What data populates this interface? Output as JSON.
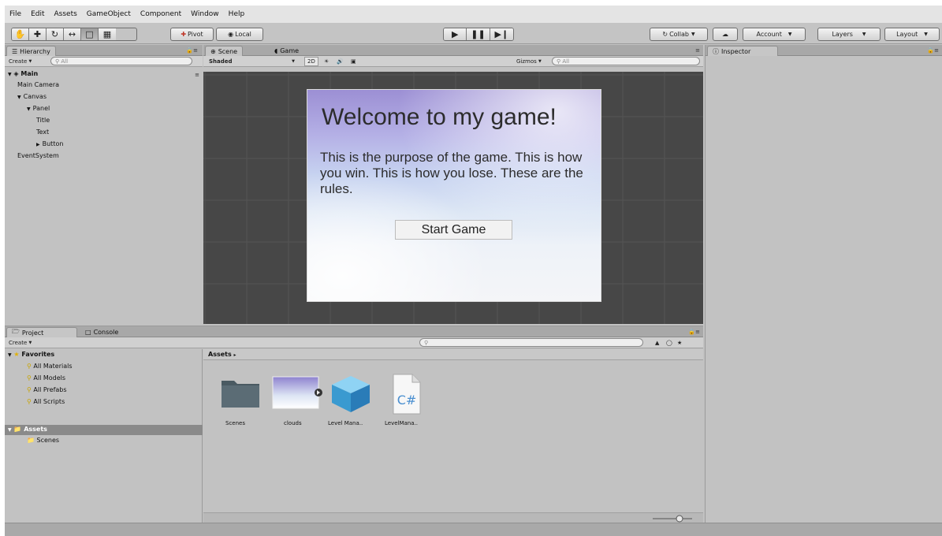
{
  "menu": [
    "File",
    "Edit",
    "Assets",
    "GameObject",
    "Component",
    "Window",
    "Help"
  ],
  "toolbar": {
    "pivot_label": "Pivot",
    "local_label": "Local",
    "collab_label": "Collab",
    "account_label": "Account",
    "layers_label": "Layers",
    "layout_label": "Layout"
  },
  "hierarchy": {
    "tab_label": "Hierarchy",
    "create_label": "Create",
    "search_placeholder": "All",
    "scene_name": "Main",
    "items": [
      {
        "label": "Main Camera",
        "indent": 1
      },
      {
        "label": "Canvas",
        "indent": 1,
        "expanded": true
      },
      {
        "label": "Panel",
        "indent": 2,
        "expanded": true
      },
      {
        "label": "Title",
        "indent": 3
      },
      {
        "label": "Text",
        "indent": 3
      },
      {
        "label": "Button",
        "indent": 3,
        "collapsed": true
      },
      {
        "label": "EventSystem",
        "indent": 1
      }
    ]
  },
  "scene": {
    "tab_scene": "Scene",
    "tab_game": "Game",
    "shading_mode": "Shaded",
    "mode_2d": "2D",
    "gizmos_label": "Gizmos",
    "search_placeholder": "All"
  },
  "game_ui": {
    "title": "Welcome to my game!",
    "body": "This is the purpose of the game. This is how you win. This is how you lose. These are the rules.",
    "button": "Start Game"
  },
  "inspector": {
    "tab_label": "Inspector"
  },
  "project": {
    "tab_project": "Project",
    "tab_console": "Console",
    "create_label": "Create",
    "favorites_label": "Favorites",
    "favorites": [
      "All Materials",
      "All Models",
      "All Prefabs",
      "All Scripts"
    ],
    "assets_label": "Assets",
    "folders": [
      "Scenes"
    ],
    "breadcrumb": "Assets",
    "asset_items": [
      {
        "label": "Scenes",
        "icon": "folder-icon"
      },
      {
        "label": "clouds",
        "icon": "texture-icon"
      },
      {
        "label": "Level Mana..",
        "icon": "prefab-cube-icon"
      },
      {
        "label": "LevelMana..",
        "icon": "csharp-script-icon"
      }
    ]
  },
  "colors": {
    "panel_bg": "#c2c2c2",
    "scene_bg": "#474747",
    "selection": "#8a8a8a"
  }
}
